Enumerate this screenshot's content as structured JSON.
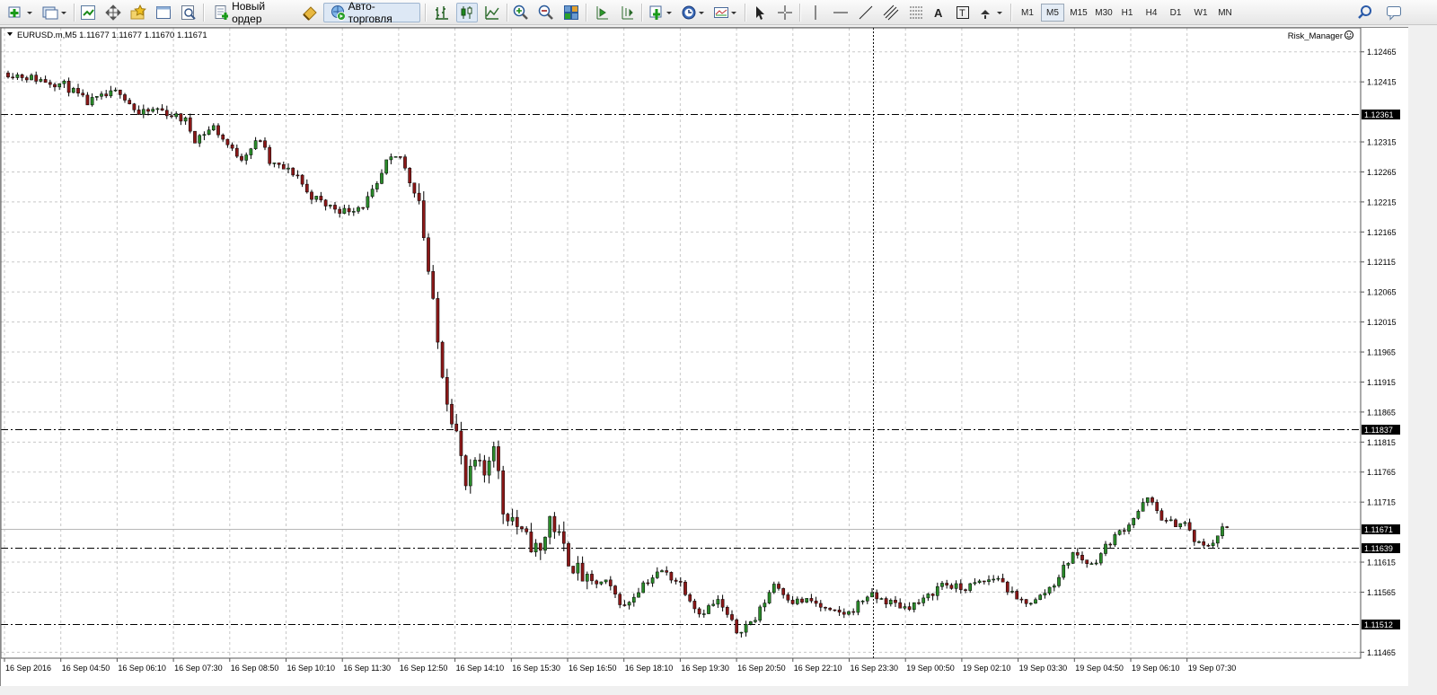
{
  "toolbar": {
    "new_order_label": "Новый ордер",
    "autotrading_label": "Авто-торговля",
    "timeframes": [
      "M1",
      "M5",
      "M15",
      "M30",
      "H1",
      "H4",
      "D1",
      "W1",
      "MN"
    ],
    "active_timeframe": "M5"
  },
  "chart": {
    "symbol_info": "EURUSD.m,M5  1.11677 1.11677 1.11670 1.11671",
    "indicator_label": "Risk_Manager",
    "colors": {
      "bull": "#2a8a2a",
      "bear": "#8a1818",
      "grid": "#c8c8c8",
      "level": "#000000"
    }
  },
  "chart_data": {
    "type": "candlestick",
    "y_ticks": [
      "1.12465",
      "1.12415",
      "1.12315",
      "1.12265",
      "1.12215",
      "1.12165",
      "1.12115",
      "1.12065",
      "1.12015",
      "1.11965",
      "1.11915",
      "1.11865",
      "1.11815",
      "1.11765",
      "1.11715",
      "1.11615",
      "1.11565",
      "1.11465"
    ],
    "y_range": [
      1.11455,
      1.12505
    ],
    "x_ticks": [
      "16 Sep 2016",
      "16 Sep 04:50",
      "16 Sep 06:10",
      "16 Sep 07:30",
      "16 Sep 08:50",
      "16 Sep 10:10",
      "16 Sep 11:30",
      "16 Sep 12:50",
      "16 Sep 14:10",
      "16 Sep 15:30",
      "16 Sep 16:50",
      "16 Sep 18:10",
      "16 Sep 19:30",
      "16 Sep 20:50",
      "16 Sep 22:10",
      "16 Sep 23:30",
      "19 Sep 00:50",
      "19 Sep 02:10",
      "19 Sep 03:30",
      "19 Sep 04:50",
      "19 Sep 06:10",
      "19 Sep 07:30"
    ],
    "levels": [
      {
        "price": 1.12361,
        "label": "1.12361"
      },
      {
        "price": 1.11837,
        "label": "1.11837"
      },
      {
        "price": 1.11639,
        "label": "1.11639"
      },
      {
        "price": 1.11512,
        "label": "1.11512"
      }
    ],
    "bid": {
      "price": 1.11671,
      "label": "1.11671"
    },
    "crosshair_time": "16 Sep 23:30",
    "path": [
      [
        0,
        1.1243
      ],
      [
        6,
        1.1242
      ],
      [
        12,
        1.1241
      ],
      [
        17,
        1.1238
      ],
      [
        24,
        1.124
      ],
      [
        28,
        1.1236
      ],
      [
        32,
        1.1237
      ],
      [
        38,
        1.1235
      ],
      [
        40,
        1.1232
      ],
      [
        44,
        1.1234
      ],
      [
        48,
        1.123
      ],
      [
        50,
        1.1229
      ],
      [
        54,
        1.1232
      ],
      [
        56,
        1.1228
      ],
      [
        62,
        1.1226
      ],
      [
        64,
        1.1223
      ],
      [
        68,
        1.1221
      ],
      [
        72,
        1.122
      ],
      [
        76,
        1.1221
      ],
      [
        79,
        1.1224
      ],
      [
        81,
        1.1228
      ],
      [
        84,
        1.1229
      ],
      [
        86,
        1.1225
      ],
      [
        88,
        1.1222
      ],
      [
        90,
        1.121
      ],
      [
        92,
        1.1198
      ],
      [
        94,
        1.1189
      ],
      [
        96,
        1.1183
      ],
      [
        98,
        1.1174
      ],
      [
        100,
        1.1178
      ],
      [
        102,
        1.1176
      ],
      [
        104,
        1.1182
      ],
      [
        106,
        1.117
      ],
      [
        108,
        1.1169
      ],
      [
        110,
        1.1166
      ],
      [
        114,
        1.1163
      ],
      [
        116,
        1.1169
      ],
      [
        120,
        1.1162
      ],
      [
        124,
        1.1158
      ],
      [
        128,
        1.1158
      ],
      [
        132,
        1.1154
      ],
      [
        136,
        1.1158
      ],
      [
        140,
        1.116
      ],
      [
        144,
        1.1158
      ],
      [
        148,
        1.1153
      ],
      [
        152,
        1.1155
      ],
      [
        156,
        1.115
      ],
      [
        160,
        1.1152
      ],
      [
        164,
        1.1158
      ],
      [
        168,
        1.1155
      ],
      [
        172,
        1.1155
      ],
      [
        176,
        1.1153
      ],
      [
        180,
        1.1153
      ],
      [
        184,
        1.1156
      ],
      [
        188,
        1.1155
      ],
      [
        192,
        1.1154
      ],
      [
        196,
        1.1155
      ],
      [
        200,
        1.1158
      ],
      [
        204,
        1.1157
      ],
      [
        208,
        1.1158
      ],
      [
        212,
        1.1159
      ],
      [
        216,
        1.1155
      ],
      [
        220,
        1.1155
      ],
      [
        224,
        1.1158
      ],
      [
        228,
        1.1163
      ],
      [
        232,
        1.1161
      ],
      [
        236,
        1.1165
      ],
      [
        240,
        1.1168
      ],
      [
        244,
        1.1172
      ],
      [
        246,
        1.117
      ],
      [
        248,
        1.1168
      ],
      [
        252,
        1.1168
      ],
      [
        254,
        1.1165
      ],
      [
        256,
        1.1164
      ],
      [
        258,
        1.1165
      ],
      [
        260,
        1.1167
      ]
    ]
  }
}
